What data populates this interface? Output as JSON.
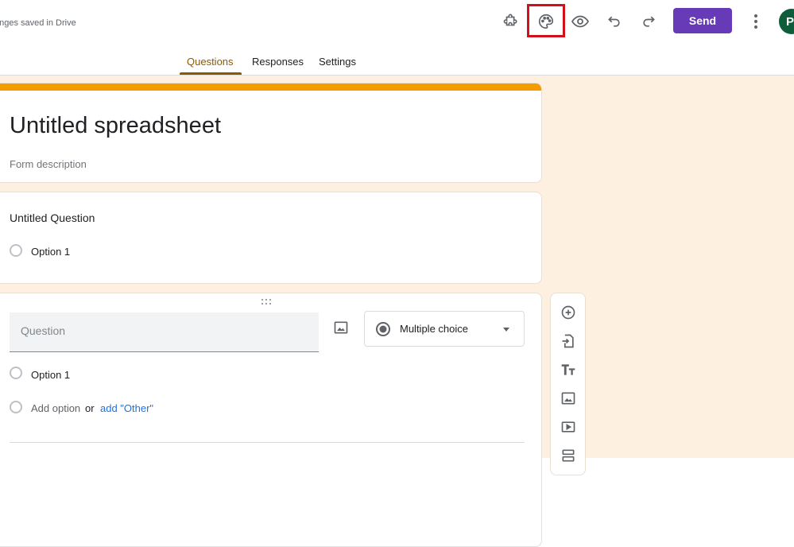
{
  "header": {
    "save_status": "anges saved in Drive",
    "send_label": "Send",
    "avatar_initial": "P"
  },
  "tabs": [
    {
      "label": "Questions",
      "active": true
    },
    {
      "label": "Responses",
      "active": false
    },
    {
      "label": "Settings",
      "active": false
    }
  ],
  "form": {
    "title": "Untitled spreadsheet",
    "description_placeholder": "Form description"
  },
  "question_1": {
    "title": "Untitled Question",
    "options": [
      "Option 1"
    ]
  },
  "question_2": {
    "placeholder": "Question",
    "type_label": "Multiple choice",
    "options": [
      "Option 1"
    ],
    "add_option": "Add option",
    "or_text": "or",
    "add_other": "add \"Other\""
  },
  "icons": {
    "header": [
      "addon-icon",
      "palette-icon",
      "preview-icon",
      "undo-icon",
      "redo-icon",
      "more-icon"
    ],
    "toolbar": [
      "add-question-icon",
      "import-questions-icon",
      "add-title-icon",
      "add-image-icon",
      "add-video-icon",
      "add-section-icon"
    ]
  },
  "colors": {
    "accent": "#673ab7",
    "tab_active": "#8a5a00",
    "theme_bar": "#f59c00",
    "background": "#fdf0e0",
    "highlight": "#d0101b"
  }
}
